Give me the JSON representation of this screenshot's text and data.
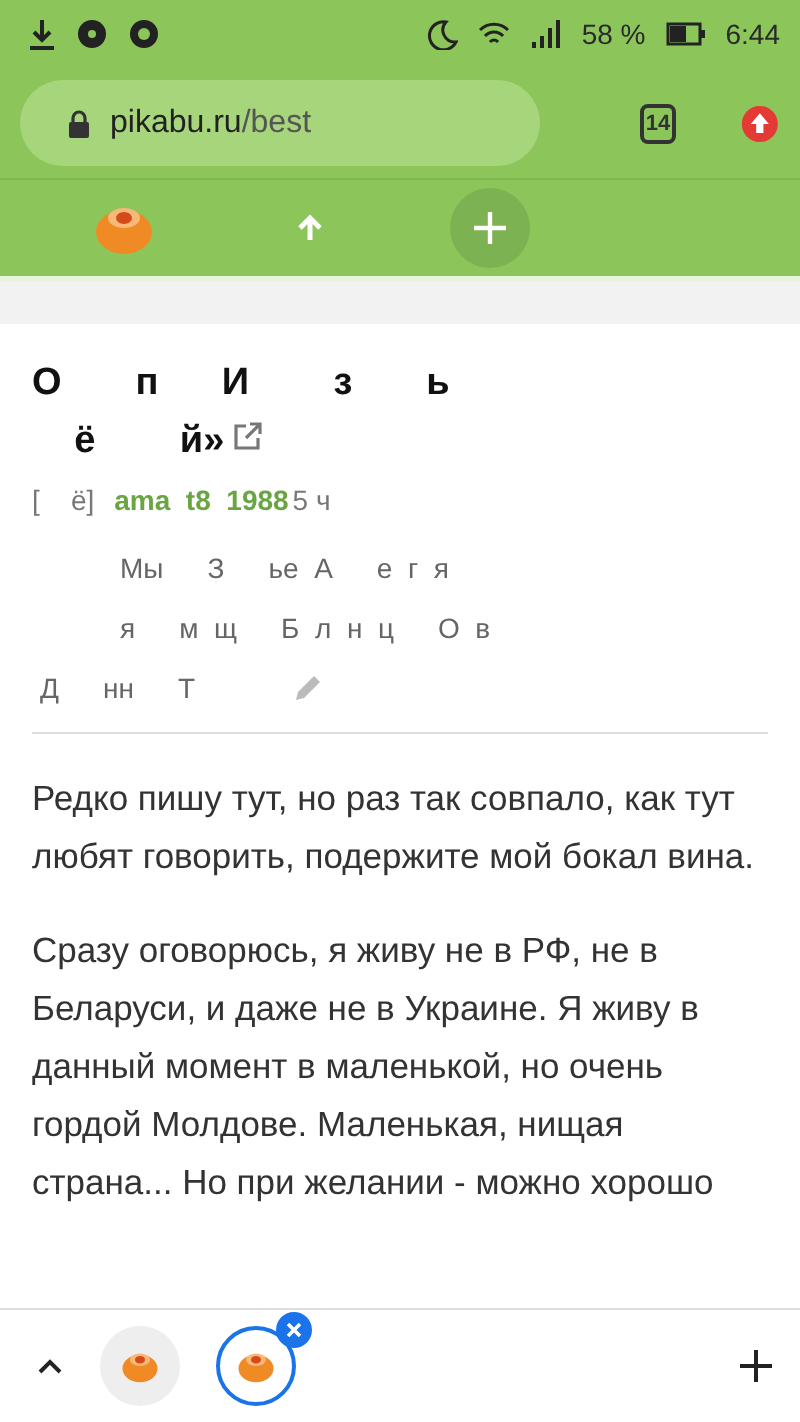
{
  "status_bar": {
    "battery_text": "58 %",
    "time": "6:44"
  },
  "browser": {
    "url_host": "pikabu.ru",
    "url_path": "/best",
    "tab_count": "14"
  },
  "post": {
    "title_lines": [
      "О       п      И        з       ь",
      "    ё        й»"
    ],
    "meta": {
      "community": "[    ё]",
      "author": "ama  t8  1988",
      "time": "5 ч"
    },
    "tags": [
      [
        "Мы",
        "З",
        "ье  А",
        "е  г  я"
      ],
      [
        "я",
        "м  щ",
        "Б  л  н  ц",
        "О  в"
      ],
      [
        "Д",
        "нн",
        "Т"
      ]
    ],
    "paragraphs": [
      "Редко пишу тут, но раз так совпало, как тут любят говорить, подержите мой бокал вина.",
      "Сразу оговорюсь, я живу не в РФ, не в Беларуси, и даже не в Украине. Я живу в данный момент  в маленькой, но очень гордой Молдове. Маленькая, нищая страна... Но при желании - можно хорошо"
    ]
  },
  "tab_strip": {
    "tabs": [
      {
        "selected": false
      },
      {
        "selected": true
      }
    ]
  }
}
